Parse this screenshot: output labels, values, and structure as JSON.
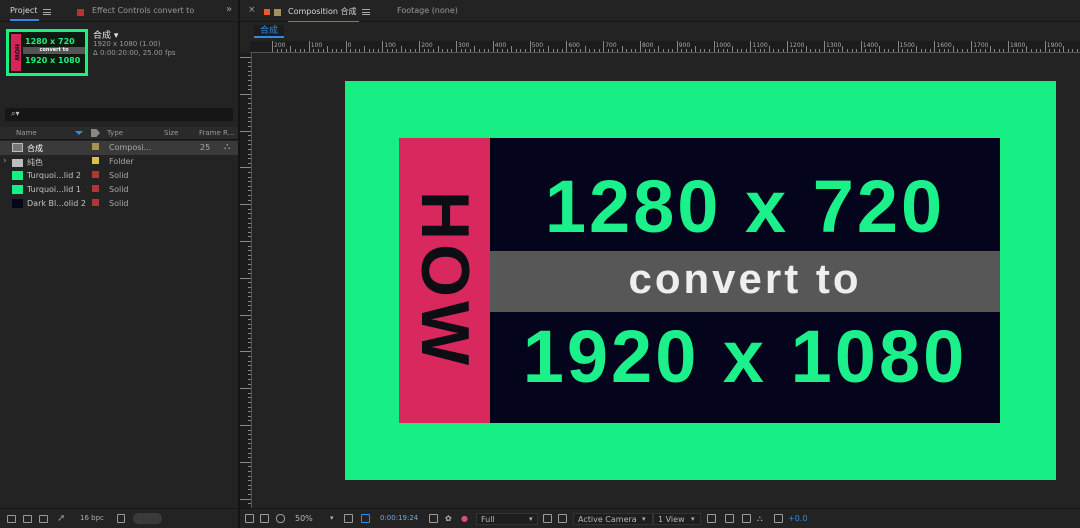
{
  "left_panel": {
    "tabs": [
      {
        "label": "Project"
      },
      {
        "label": "Effect Controls  convert to"
      }
    ],
    "overflow_icon": "double-chevron-right",
    "thumbnail": {
      "top_text": "1280 x 720",
      "mid_text": "convert to",
      "bottom_text": "1920 x 1080",
      "side_text": "HOW"
    },
    "info": {
      "name": "合成 ▾",
      "line1": "1920 x 1080 (1.00)",
      "line2": "Δ 0:00:20:00, 25.00 fps"
    },
    "search_placeholder": "⌕▾",
    "columns": {
      "name": "Name",
      "type": "Type",
      "size": "Size",
      "frame_rate": "Frame R..."
    },
    "rows": [
      {
        "name": "合成",
        "type": "Composi...",
        "frame": "25",
        "swatch": "#a9905a"
      },
      {
        "name": "纯色",
        "type": "Folder",
        "frame": "",
        "swatch": "#d9c24a"
      },
      {
        "name": "Turquoi...lid 2",
        "type": "Solid",
        "frame": "",
        "swatch": "#b03535"
      },
      {
        "name": "Turquoi...lid 1",
        "type": "Solid",
        "frame": "",
        "swatch": "#b03535"
      },
      {
        "name": "Dark Bl...olid 2",
        "type": "Solid",
        "frame": "",
        "swatch": "#b03535"
      }
    ],
    "bpc_label": "16 bpc"
  },
  "comp_panel": {
    "tabs": [
      {
        "label": "Composition 合成"
      },
      {
        "label": "Footage  (none)"
      }
    ],
    "comp_chip": "合成",
    "ruler_labels": [
      "200",
      "100",
      "0",
      "100",
      "200",
      "300",
      "400",
      "500",
      "600",
      "700",
      "800",
      "900",
      "1000",
      "1100",
      "1200",
      "1300",
      "1400",
      "1500",
      "1600",
      "1700",
      "1800",
      "1900"
    ],
    "canvas": {
      "side_text": "HOW",
      "line1": "1280 x 720",
      "line2": "convert to",
      "line3": "1920 x 1080"
    },
    "bottom_bar": {
      "zoom": "50%",
      "timecode": "0:00:19:24",
      "resolution": "Full",
      "camera": "Active Camera",
      "view": "1 View",
      "exposure": "+0.0"
    }
  },
  "colors": {
    "accent": "#2d8ceb",
    "green": "#17ef85",
    "navy": "#04041d",
    "pink": "#d8285e",
    "grey_band": "#575757"
  }
}
